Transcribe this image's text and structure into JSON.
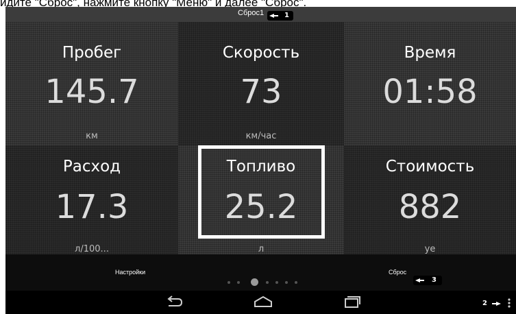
{
  "caption": "идите \"Сброс\", нажмите кнопку \"Меню\" и далее \"Сброс\".",
  "topbar": {
    "title": "Сброс1"
  },
  "tiles": [
    {
      "label": "Пробег",
      "value": "145.7",
      "unit": "км"
    },
    {
      "label": "Скорость",
      "value": "73",
      "unit": "км/час"
    },
    {
      "label": "Время",
      "value": "01:58",
      "unit": ""
    },
    {
      "label": "Расход",
      "value": "17.3",
      "unit": "л/100..."
    },
    {
      "label": "Топливо",
      "value": "25.2",
      "unit": "л"
    },
    {
      "label": "Стоимость",
      "value": "882",
      "unit": "уе"
    }
  ],
  "actions": {
    "settings_label": "Настройки",
    "reset_label": "Сброс"
  },
  "page_indicator": {
    "count": 7,
    "active_index": 2
  },
  "markers": {
    "m1": "1",
    "m2": "2",
    "m3": "3"
  },
  "icons": {
    "back": "back-arrow-icon",
    "home": "home-icon",
    "recents": "recent-apps-icon",
    "menu": "overflow-menu-icon",
    "pointer": "pointing-hand-icon"
  },
  "colors": {
    "background": "#3a3a3a",
    "dark_tile": "#2b2b2b",
    "action_bar": "#0d0d0d",
    "nav_bar": "#000000",
    "text": "#ffffff",
    "highlight_border": "#ffffff"
  }
}
